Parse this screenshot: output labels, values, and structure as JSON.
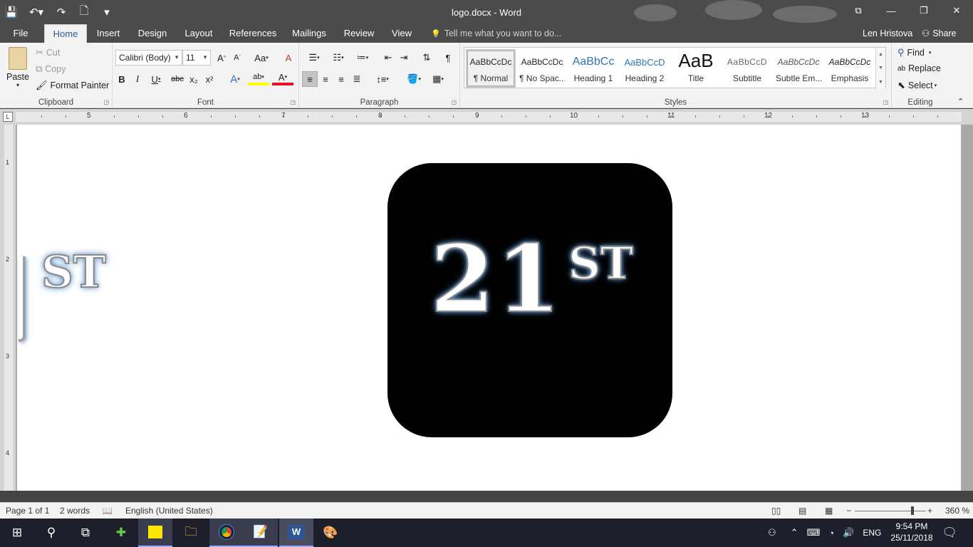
{
  "window": {
    "title": "logo.docx - Word"
  },
  "qat": {
    "save": "💾",
    "undo": "↶▾",
    "redo": "↷",
    "new": "🗋",
    "customize": "▾"
  },
  "winctrl": {
    "ribbon_options": "⧉",
    "minimize": "—",
    "restore": "❐",
    "close": "✕"
  },
  "tabs": [
    "File",
    "Home",
    "Insert",
    "Design",
    "Layout",
    "References",
    "Mailings",
    "Review",
    "View"
  ],
  "tellme": {
    "icon": "💡",
    "text": "Tell me what you want to do..."
  },
  "account": {
    "user": "Len Hristova",
    "share": "Share"
  },
  "clipboard": {
    "paste": "Paste",
    "cut": "Cut",
    "copy": "Copy",
    "format_painter": "Format Painter",
    "label": "Clipboard"
  },
  "font": {
    "name": "Calibri (Body)",
    "size": "11",
    "grow": "A",
    "shrink": "A",
    "case": "Aa",
    "clear": "A",
    "bold": "B",
    "italic": "I",
    "underline": "U",
    "strike": "abc",
    "sub": "x₂",
    "sup": "x²",
    "effects": "A",
    "highlight": "ab",
    "color": "A",
    "label": "Font"
  },
  "paragraph": {
    "label": "Paragraph",
    "pilcrow": "¶"
  },
  "styles": {
    "label": "Styles",
    "items": [
      {
        "preview": "AaBbCcDc",
        "name": "¶ Normal"
      },
      {
        "preview": "AaBbCcDc",
        "name": "¶ No Spac..."
      },
      {
        "preview": "AaBbCc",
        "name": "Heading 1"
      },
      {
        "preview": "AaBbCcD",
        "name": "Heading 2"
      },
      {
        "preview": "AaB",
        "name": "Title"
      },
      {
        "preview": "AaBbCcD",
        "name": "Subtitle"
      },
      {
        "preview": "AaBbCcDc",
        "name": "Subtle Em..."
      },
      {
        "preview": "AaBbCcDc",
        "name": "Emphasis"
      }
    ]
  },
  "editing": {
    "find": "Find",
    "replace": "Replace",
    "select": "Select",
    "label": "Editing"
  },
  "ruler": {
    "h": [
      "5",
      "6",
      "7",
      "8",
      "9",
      "10",
      "11",
      "12",
      "13"
    ],
    "v": [
      "1",
      "2",
      "3",
      "4"
    ],
    "corner": "L"
  },
  "document": {
    "logo_number": "21",
    "logo_sup": "ST",
    "ghost_sup": "ST"
  },
  "status": {
    "page": "Page 1 of 1",
    "words": "2 words",
    "language": "English (United States)",
    "zoom": "360 %"
  },
  "tray": {
    "lang": "ENG",
    "time": "9:54 PM",
    "date": "25/11/2018"
  }
}
